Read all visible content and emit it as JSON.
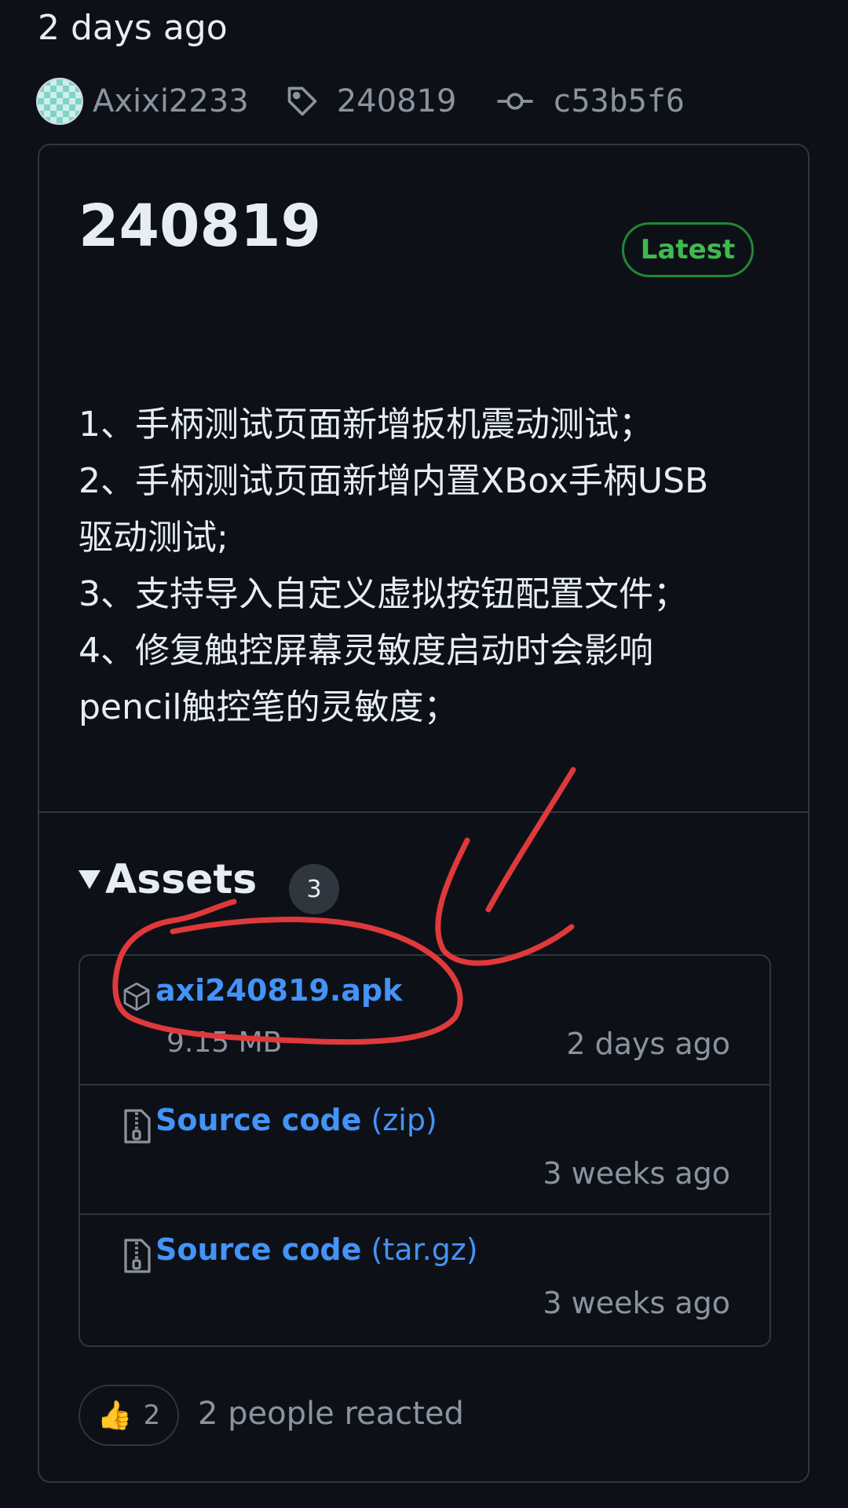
{
  "header": {
    "relative_date": "2 days ago",
    "author": "Axixi2233",
    "tag": "240819",
    "commit": "c53b5f6"
  },
  "release": {
    "title": "240819",
    "badge": "Latest",
    "notes": [
      "1、手柄测试页面新增扳机震动测试；",
      "2、手柄测试页面新增内置XBox手柄USB",
      "驱动测试;",
      "3、支持导入自定义虚拟按钮配置文件；",
      "4、修复触控屏幕灵敏度启动时会影响",
      "pencil触控笔的灵敏度；"
    ]
  },
  "assets": {
    "title": "Assets",
    "count": "3",
    "items": [
      {
        "name": "axi240819.apk",
        "suffix": "",
        "size": "9.15 MB",
        "date": "2 days ago",
        "icon": "package-icon"
      },
      {
        "name": "Source code",
        "suffix": " (zip)",
        "size": "",
        "date": "3 weeks ago",
        "icon": "file-zip-icon"
      },
      {
        "name": "Source code",
        "suffix": " (tar.gz)",
        "size": "",
        "date": "3 weeks ago",
        "icon": "file-zip-icon"
      }
    ]
  },
  "reactions": {
    "emoji": "👍",
    "count": "2",
    "summary": "2 people reacted"
  },
  "colors": {
    "background": "#0d1117",
    "border": "#30363d",
    "link": "#4493f8",
    "latest_green": "#3fb950",
    "annotation_red": "#e0393b"
  }
}
